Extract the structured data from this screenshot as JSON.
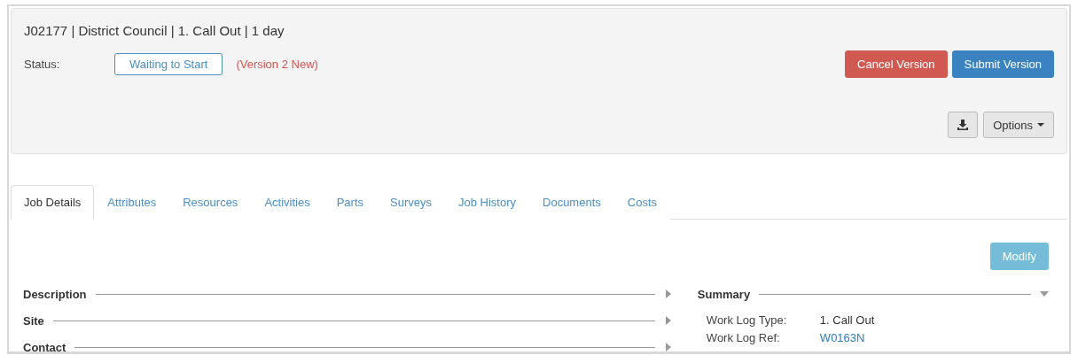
{
  "header": {
    "title": "J02177 | District Council | 1. Call Out | 1 day",
    "status_label": "Status:",
    "status": "Waiting to Start",
    "version_note": "(Version 2 New)",
    "actions": [
      {
        "label": "Cancel Version",
        "kind": "danger"
      },
      {
        "label": "Submit Version",
        "kind": "primary"
      }
    ],
    "options": {
      "label": "Options"
    }
  },
  "tabs": [
    {
      "label": "Job Details",
      "selected": true
    },
    {
      "label": "Attributes",
      "selected": false
    },
    {
      "label": "Resources",
      "selected": false
    },
    {
      "label": "Activities",
      "selected": false
    },
    {
      "label": "Parts",
      "selected": false
    },
    {
      "label": "Surveys",
      "selected": false
    },
    {
      "label": "Job History",
      "selected": false
    },
    {
      "label": "Documents",
      "selected": false
    },
    {
      "label": "Costs",
      "selected": false
    }
  ],
  "modify_button": {
    "label": "Modify",
    "disabled": true
  },
  "left_sections": [
    {
      "title": "Description",
      "expanded": false
    },
    {
      "title": "Site",
      "expanded": false
    },
    {
      "title": "Contact",
      "expanded": false
    }
  ],
  "summary": {
    "title": "Summary",
    "expanded": true,
    "rows": [
      {
        "label": "Work Log Type:",
        "value": "1. Call Out",
        "kind": "text"
      },
      {
        "label": "Work Log Ref:",
        "value": "W0163N",
        "kind": "link"
      }
    ]
  }
}
